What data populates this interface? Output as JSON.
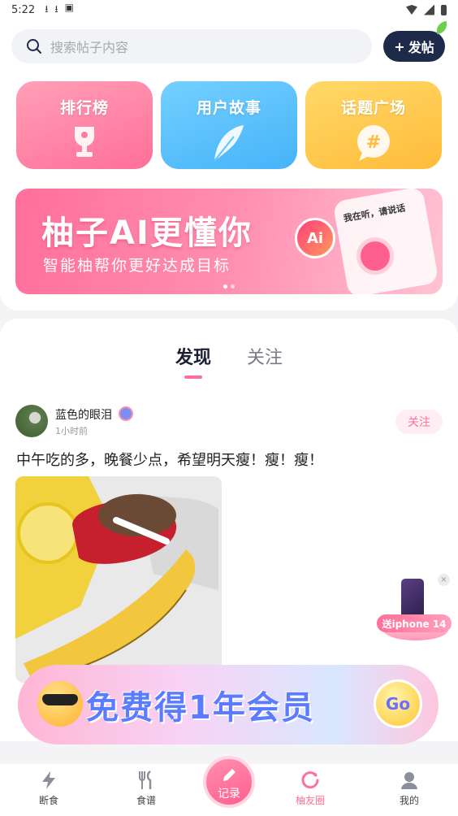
{
  "status_bar": {
    "time": "5:22"
  },
  "search": {
    "placeholder": "搜索帖子内容"
  },
  "post_button": {
    "label": "发帖"
  },
  "tiles": [
    {
      "label": "排行榜"
    },
    {
      "label": "用户故事"
    },
    {
      "label": "话题广场"
    }
  ],
  "banner": {
    "title": "柚子AI更懂你",
    "subtitle": "智能柚帮你更好达成目标",
    "card_text": "我在听，请说话",
    "ai_badge": "Ai"
  },
  "feed_tabs": [
    {
      "label": "发现",
      "active": true
    },
    {
      "label": "关注",
      "active": false
    }
  ],
  "post": {
    "username": "蓝色的眼泪",
    "time": "1小时前",
    "follow_label": "关注",
    "text": "中午吃的多，晚餐少点，希望明天瘦！瘦！瘦！"
  },
  "promo_float": {
    "label": "送iphone 14",
    "close": "×"
  },
  "promo_banner": {
    "text": "免费得1年会员",
    "go": "Go"
  },
  "bottom_nav": {
    "items": [
      {
        "label": "断食",
        "icon": "lightning-icon"
      },
      {
        "label": "食谱",
        "icon": "fork-knife-icon"
      },
      {
        "label": "柚友圈",
        "icon": "circle-refresh-icon",
        "active": true
      },
      {
        "label": "我的",
        "icon": "profile-icon"
      }
    ],
    "record_label": "记录"
  },
  "colors": {
    "accent": "#ff6f98",
    "dark_button": "#1e2a4a"
  }
}
